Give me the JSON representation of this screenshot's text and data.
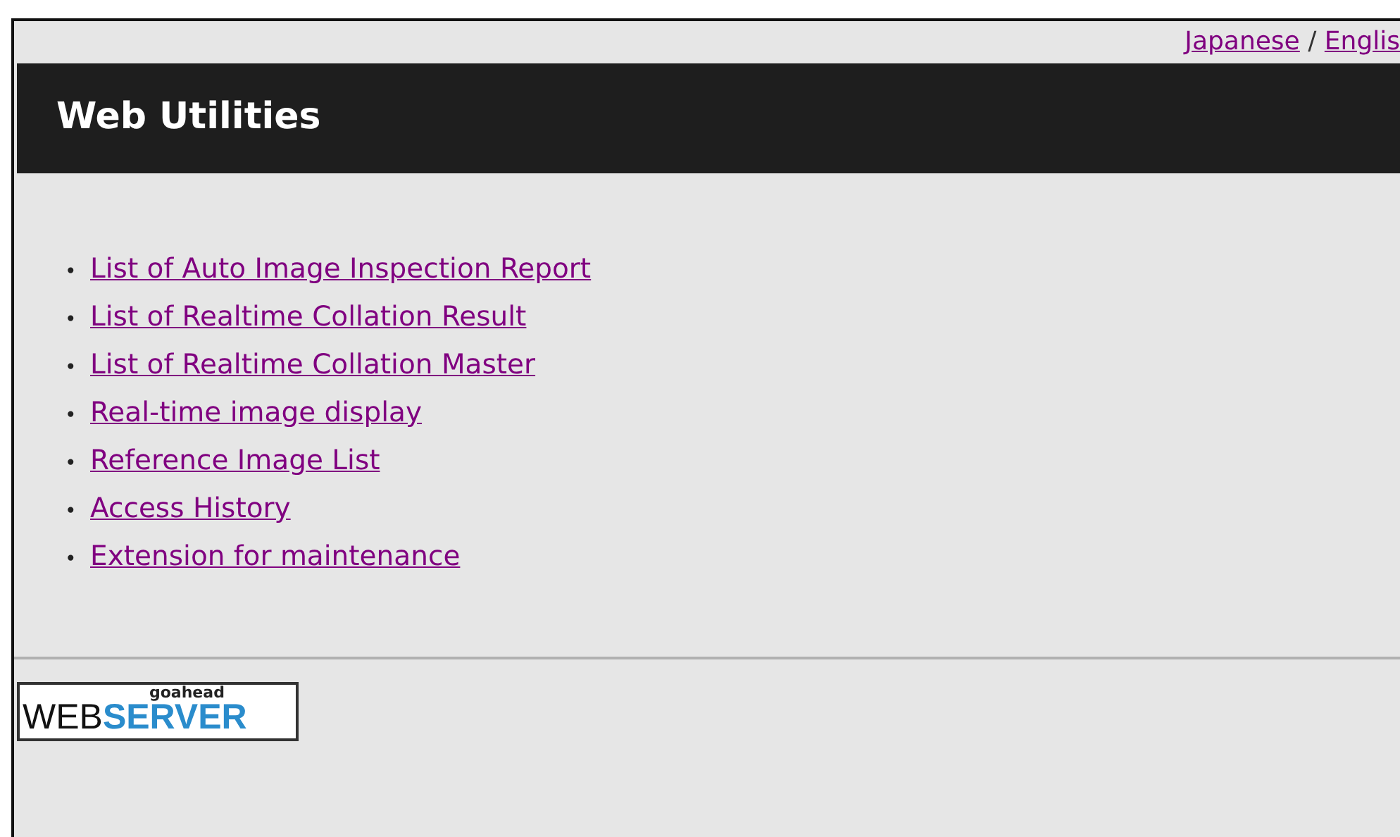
{
  "language_links": [
    {
      "label": "Japanese"
    },
    {
      "label": "Englis"
    }
  ],
  "language_separator": "/",
  "header": {
    "title": "Web Utilities"
  },
  "bullet": "•",
  "links": [
    {
      "label": "List of Auto Image Inspection Report"
    },
    {
      "label": "List of Realtime Collation Result"
    },
    {
      "label": "List of Realtime Collation Master"
    },
    {
      "label": "Real-time image display"
    },
    {
      "label": "Reference Image List"
    },
    {
      "label": "Access History"
    },
    {
      "label": "Extension for maintenance"
    }
  ],
  "logo": {
    "top": "goahead",
    "left": "WEB",
    "right": "SERVER"
  }
}
